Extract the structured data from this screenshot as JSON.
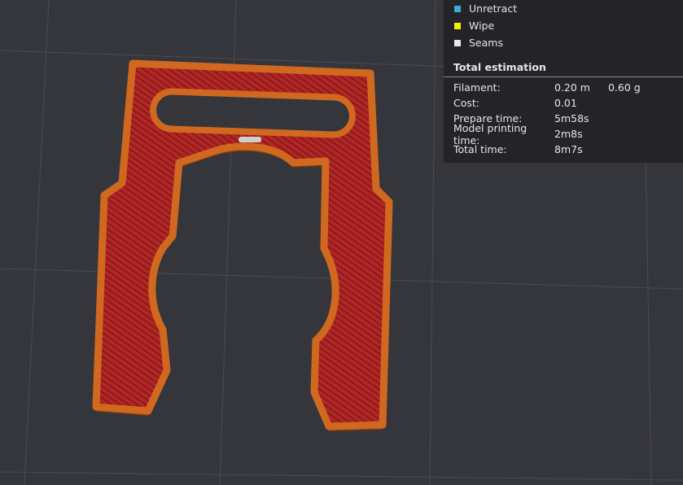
{
  "legend": [
    {
      "label": "Unretract",
      "color": "#3fa9d6"
    },
    {
      "label": "Wipe",
      "color": "#f0f000"
    },
    {
      "label": "Seams",
      "color": "#e8e8e8"
    }
  ],
  "estimation": {
    "title": "Total estimation",
    "filament_label": "Filament:",
    "filament_length": "0.20 m",
    "filament_weight": "0.60 g",
    "cost_label": "Cost:",
    "cost": "0.01",
    "prepare_label": "Prepare time:",
    "prepare": "5m58s",
    "model_label": "Model printing time:",
    "model": "2m8s",
    "total_label": "Total time:",
    "total": "8m7s"
  },
  "colors": {
    "outer_wall": "#c8621c",
    "infill": "#b82a2a",
    "background": "#35363c"
  }
}
